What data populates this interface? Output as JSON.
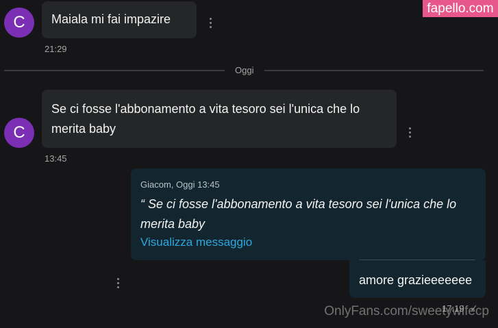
{
  "watermark_top": "fapello.com",
  "watermark_bottom": "OnlyFans.com/sweetywifecp",
  "divider_label": "Oggi",
  "messages": [
    {
      "avatar_initial": "C",
      "text": "Maiala mi fai impazire",
      "time": "21:29"
    },
    {
      "avatar_initial": "C",
      "text": "Se ci fosse l'abbonamento a vita tesoro sei l'unica che lo merita baby",
      "time": "13:45"
    }
  ],
  "reply": {
    "quote_meta": "Giacom, Oggi 13:45",
    "quote_text": "“ Se ci fosse l'abbonamento a vita tesoro sei l'unica che lo merita baby",
    "quote_link": "Visualizza messaggio",
    "text": "amore grazieeeeeee",
    "time": "17:19"
  },
  "icons": {
    "menu": "kebab-menu-icon",
    "read_status": "check-icon"
  },
  "colors": {
    "avatar": "#7b2fb5",
    "link": "#2ea8e0",
    "out_bubble": "#13262f",
    "in_bubble": "#242628",
    "watermark": "#e8578a"
  }
}
